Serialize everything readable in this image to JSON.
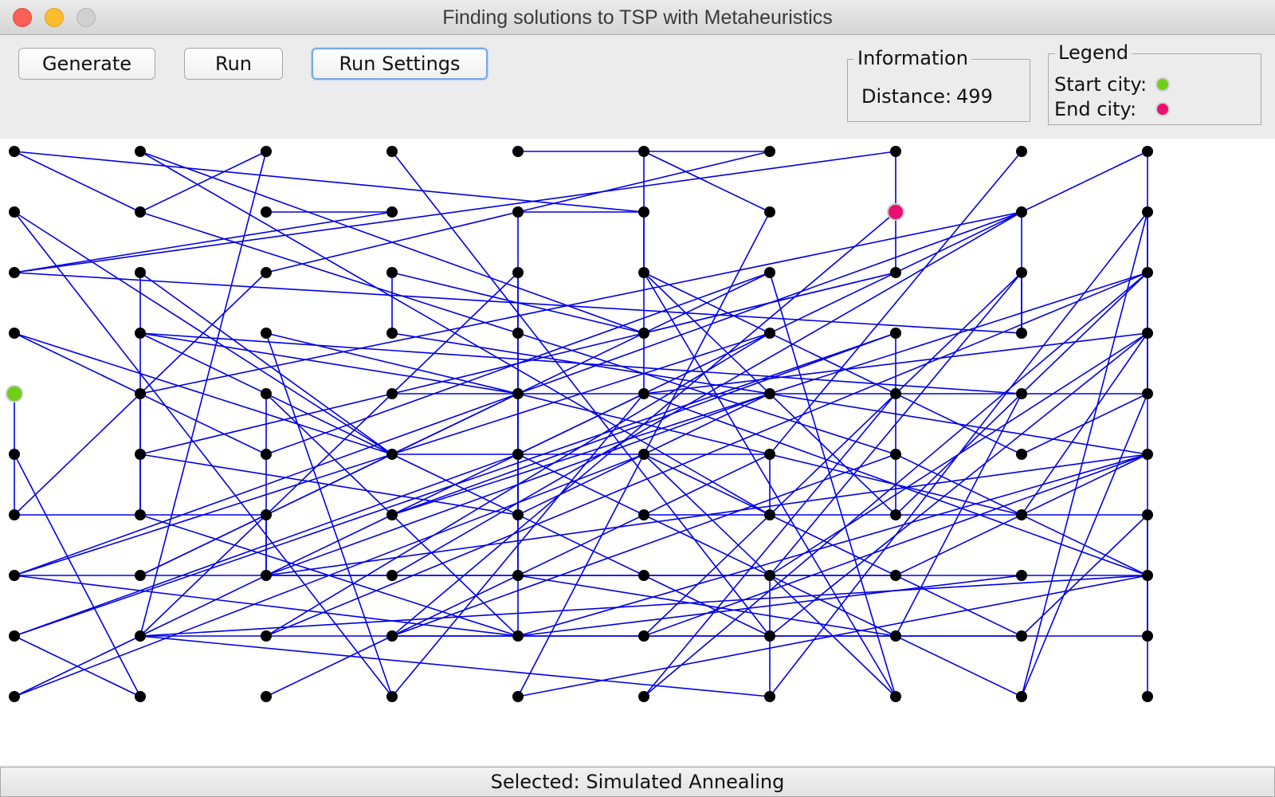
{
  "window": {
    "title": "Finding solutions to TSP with Metaheuristics"
  },
  "toolbar": {
    "generate_label": "Generate",
    "run_label": "Run",
    "run_settings_label": "Run Settings"
  },
  "information": {
    "title": "Information",
    "distance_label": "Distance:",
    "distance_value": "499"
  },
  "legend": {
    "title": "Legend",
    "start_label": "Start city:",
    "end_label": "End city:",
    "start_color": "#6fcf16",
    "end_color": "#ea0f72"
  },
  "status": {
    "text": "Selected:  Simulated Annealing"
  },
  "map": {
    "city_color": "#000000",
    "route_color": "#0000e6",
    "grid_columns": 10,
    "grid_rows": 10,
    "start_city": [
      0,
      4
    ],
    "end_city": [
      7,
      1
    ],
    "edges": [
      [
        [
          0,
          0
        ],
        [
          1,
          1
        ]
      ],
      [
        [
          0,
          0
        ],
        [
          5,
          1
        ]
      ],
      [
        [
          1,
          0
        ],
        [
          5,
          3
        ]
      ],
      [
        [
          1,
          0
        ],
        [
          6,
          6
        ]
      ],
      [
        [
          2,
          0
        ],
        [
          1,
          1
        ]
      ],
      [
        [
          2,
          0
        ],
        [
          1,
          8
        ]
      ],
      [
        [
          3,
          0
        ],
        [
          6,
          8
        ]
      ],
      [
        [
          4,
          0
        ],
        [
          5,
          0
        ]
      ],
      [
        [
          5,
          0
        ],
        [
          6,
          0
        ]
      ],
      [
        [
          5,
          0
        ],
        [
          6,
          1
        ]
      ],
      [
        [
          5,
          0
        ],
        [
          5,
          4
        ]
      ],
      [
        [
          6,
          0
        ],
        [
          2,
          2
        ]
      ],
      [
        [
          7,
          0
        ],
        [
          7,
          1
        ]
      ],
      [
        [
          7,
          0
        ],
        [
          0,
          2
        ]
      ],
      [
        [
          8,
          0
        ],
        [
          6,
          5
        ]
      ],
      [
        [
          9,
          0
        ],
        [
          4,
          5
        ]
      ],
      [
        [
          9,
          0
        ],
        [
          9,
          4
        ]
      ],
      [
        [
          0,
          1
        ],
        [
          3,
          5
        ]
      ],
      [
        [
          0,
          1
        ],
        [
          3,
          9
        ]
      ],
      [
        [
          1,
          1
        ],
        [
          4,
          3
        ]
      ],
      [
        [
          2,
          1
        ],
        [
          3,
          1
        ]
      ],
      [
        [
          3,
          1
        ],
        [
          0,
          2
        ]
      ],
      [
        [
          4,
          1
        ],
        [
          4,
          8
        ]
      ],
      [
        [
          4,
          1
        ],
        [
          5,
          1
        ]
      ],
      [
        [
          5,
          1
        ],
        [
          5,
          2
        ]
      ],
      [
        [
          6,
          1
        ],
        [
          4,
          9
        ]
      ],
      [
        [
          7,
          1
        ],
        [
          3,
          8
        ]
      ],
      [
        [
          7,
          1
        ],
        [
          7,
          2
        ]
      ],
      [
        [
          8,
          1
        ],
        [
          8,
          3
        ]
      ],
      [
        [
          8,
          1
        ],
        [
          0,
          7
        ]
      ],
      [
        [
          9,
          1
        ],
        [
          9,
          9
        ]
      ],
      [
        [
          9,
          1
        ],
        [
          6,
          9
        ]
      ],
      [
        [
          0,
          2
        ],
        [
          8,
          3
        ]
      ],
      [
        [
          1,
          2
        ],
        [
          1,
          6
        ]
      ],
      [
        [
          1,
          2
        ],
        [
          3,
          5
        ]
      ],
      [
        [
          2,
          2
        ],
        [
          0,
          6
        ]
      ],
      [
        [
          3,
          2
        ],
        [
          3,
          3
        ]
      ],
      [
        [
          3,
          2
        ],
        [
          5,
          3
        ]
      ],
      [
        [
          4,
          2
        ],
        [
          4,
          7
        ]
      ],
      [
        [
          4,
          2
        ],
        [
          1,
          8
        ]
      ],
      [
        [
          5,
          2
        ],
        [
          8,
          5
        ]
      ],
      [
        [
          5,
          2
        ],
        [
          7,
          6
        ]
      ],
      [
        [
          6,
          2
        ],
        [
          7,
          9
        ]
      ],
      [
        [
          7,
          2
        ],
        [
          1,
          5
        ]
      ],
      [
        [
          8,
          2
        ],
        [
          6,
          7
        ]
      ],
      [
        [
          9,
          2
        ],
        [
          3,
          6
        ]
      ],
      [
        [
          0,
          3
        ],
        [
          3,
          5
        ]
      ],
      [
        [
          0,
          3
        ],
        [
          2,
          5
        ]
      ],
      [
        [
          1,
          3
        ],
        [
          8,
          4
        ]
      ],
      [
        [
          1,
          3
        ],
        [
          4,
          4
        ]
      ],
      [
        [
          1,
          3
        ],
        [
          6,
          8
        ]
      ],
      [
        [
          2,
          3
        ],
        [
          8,
          6
        ]
      ],
      [
        [
          2,
          3
        ],
        [
          3,
          9
        ]
      ],
      [
        [
          3,
          3
        ],
        [
          9,
          5
        ]
      ],
      [
        [
          4,
          3
        ],
        [
          7,
          5
        ]
      ],
      [
        [
          5,
          3
        ],
        [
          7,
          2
        ]
      ],
      [
        [
          6,
          3
        ],
        [
          0,
          7
        ]
      ],
      [
        [
          6,
          3
        ],
        [
          2,
          8
        ]
      ],
      [
        [
          7,
          3
        ],
        [
          7,
          6
        ]
      ],
      [
        [
          8,
          3
        ],
        [
          8,
          2
        ]
      ],
      [
        [
          9,
          3
        ],
        [
          5,
          4
        ]
      ],
      [
        [
          9,
          3
        ],
        [
          6,
          7
        ]
      ],
      [
        [
          0,
          4
        ],
        [
          0,
          5
        ]
      ],
      [
        [
          1,
          4
        ],
        [
          1,
          6
        ]
      ],
      [
        [
          1,
          4
        ],
        [
          8,
          1
        ]
      ],
      [
        [
          2,
          4
        ],
        [
          2,
          7
        ]
      ],
      [
        [
          2,
          4
        ],
        [
          4,
          8
        ]
      ],
      [
        [
          3,
          4
        ],
        [
          9,
          4
        ]
      ],
      [
        [
          4,
          4
        ],
        [
          4,
          6
        ]
      ],
      [
        [
          4,
          4
        ],
        [
          1,
          7
        ]
      ],
      [
        [
          5,
          4
        ],
        [
          9,
          7
        ]
      ],
      [
        [
          5,
          4
        ],
        [
          0,
          9
        ]
      ],
      [
        [
          6,
          4
        ],
        [
          2,
          7
        ]
      ],
      [
        [
          7,
          4
        ],
        [
          5,
          9
        ]
      ],
      [
        [
          8,
          4
        ],
        [
          7,
          8
        ]
      ],
      [
        [
          9,
          4
        ],
        [
          8,
          9
        ]
      ],
      [
        [
          0,
          5
        ],
        [
          0,
          6
        ]
      ],
      [
        [
          0,
          5
        ],
        [
          1,
          9
        ]
      ],
      [
        [
          1,
          5
        ],
        [
          4,
          6
        ]
      ],
      [
        [
          2,
          5
        ],
        [
          6,
          2
        ]
      ],
      [
        [
          3,
          5
        ],
        [
          6,
          5
        ]
      ],
      [
        [
          4,
          5
        ],
        [
          7,
          8
        ]
      ],
      [
        [
          4,
          5
        ],
        [
          0,
          8
        ]
      ],
      [
        [
          5,
          5
        ],
        [
          6,
          6
        ]
      ],
      [
        [
          5,
          5
        ],
        [
          7,
          9
        ]
      ],
      [
        [
          6,
          5
        ],
        [
          6,
          6
        ]
      ],
      [
        [
          7,
          5
        ],
        [
          9,
          7
        ]
      ],
      [
        [
          8,
          5
        ],
        [
          9,
          4
        ]
      ],
      [
        [
          9,
          5
        ],
        [
          5,
          8
        ]
      ],
      [
        [
          9,
          5
        ],
        [
          2,
          7
        ]
      ],
      [
        [
          0,
          6
        ],
        [
          2,
          6
        ]
      ],
      [
        [
          1,
          6
        ],
        [
          4,
          8
        ]
      ],
      [
        [
          2,
          6
        ],
        [
          2,
          7
        ]
      ],
      [
        [
          3,
          6
        ],
        [
          7,
          3
        ]
      ],
      [
        [
          4,
          6
        ],
        [
          6,
          4
        ]
      ],
      [
        [
          5,
          6
        ],
        [
          9,
          6
        ]
      ],
      [
        [
          6,
          6
        ],
        [
          8,
          8
        ]
      ],
      [
        [
          7,
          6
        ],
        [
          9,
          2
        ]
      ],
      [
        [
          8,
          6
        ],
        [
          9,
          3
        ]
      ],
      [
        [
          9,
          6
        ],
        [
          9,
          8
        ]
      ],
      [
        [
          0,
          7
        ],
        [
          5,
          7
        ]
      ],
      [
        [
          0,
          7
        ],
        [
          4,
          8
        ]
      ],
      [
        [
          1,
          7
        ],
        [
          6,
          2
        ]
      ],
      [
        [
          2,
          7
        ],
        [
          9,
          7
        ]
      ],
      [
        [
          3,
          7
        ],
        [
          8,
          1
        ]
      ],
      [
        [
          4,
          7
        ],
        [
          7,
          8
        ]
      ],
      [
        [
          5,
          7
        ],
        [
          7,
          7
        ]
      ],
      [
        [
          6,
          7
        ],
        [
          6,
          9
        ]
      ],
      [
        [
          7,
          7
        ],
        [
          9,
          5
        ]
      ],
      [
        [
          8,
          7
        ],
        [
          4,
          8
        ]
      ],
      [
        [
          9,
          7
        ],
        [
          1,
          8
        ]
      ],
      [
        [
          0,
          8
        ],
        [
          7,
          3
        ]
      ],
      [
        [
          1,
          8
        ],
        [
          9,
          8
        ]
      ],
      [
        [
          2,
          8
        ],
        [
          9,
          2
        ]
      ],
      [
        [
          3,
          8
        ],
        [
          8,
          8
        ]
      ],
      [
        [
          3,
          8
        ],
        [
          7,
          5
        ]
      ],
      [
        [
          4,
          8
        ],
        [
          9,
          5
        ]
      ],
      [
        [
          5,
          8
        ],
        [
          8,
          2
        ]
      ],
      [
        [
          6,
          8
        ],
        [
          9,
          3
        ]
      ],
      [
        [
          7,
          8
        ],
        [
          8,
          9
        ]
      ],
      [
        [
          8,
          8
        ],
        [
          9,
          6
        ]
      ],
      [
        [
          0,
          9
        ],
        [
          5,
          5
        ]
      ],
      [
        [
          1,
          9
        ],
        [
          0,
          8
        ]
      ],
      [
        [
          2,
          9
        ],
        [
          6,
          5
        ]
      ],
      [
        [
          3,
          9
        ],
        [
          5,
          4
        ]
      ],
      [
        [
          4,
          9
        ],
        [
          9,
          7
        ]
      ],
      [
        [
          5,
          9
        ],
        [
          9,
          2
        ]
      ],
      [
        [
          6,
          9
        ],
        [
          1,
          8
        ]
      ],
      [
        [
          7,
          9
        ],
        [
          5,
          2
        ]
      ],
      [
        [
          8,
          9
        ],
        [
          9,
          1
        ]
      ]
    ]
  }
}
